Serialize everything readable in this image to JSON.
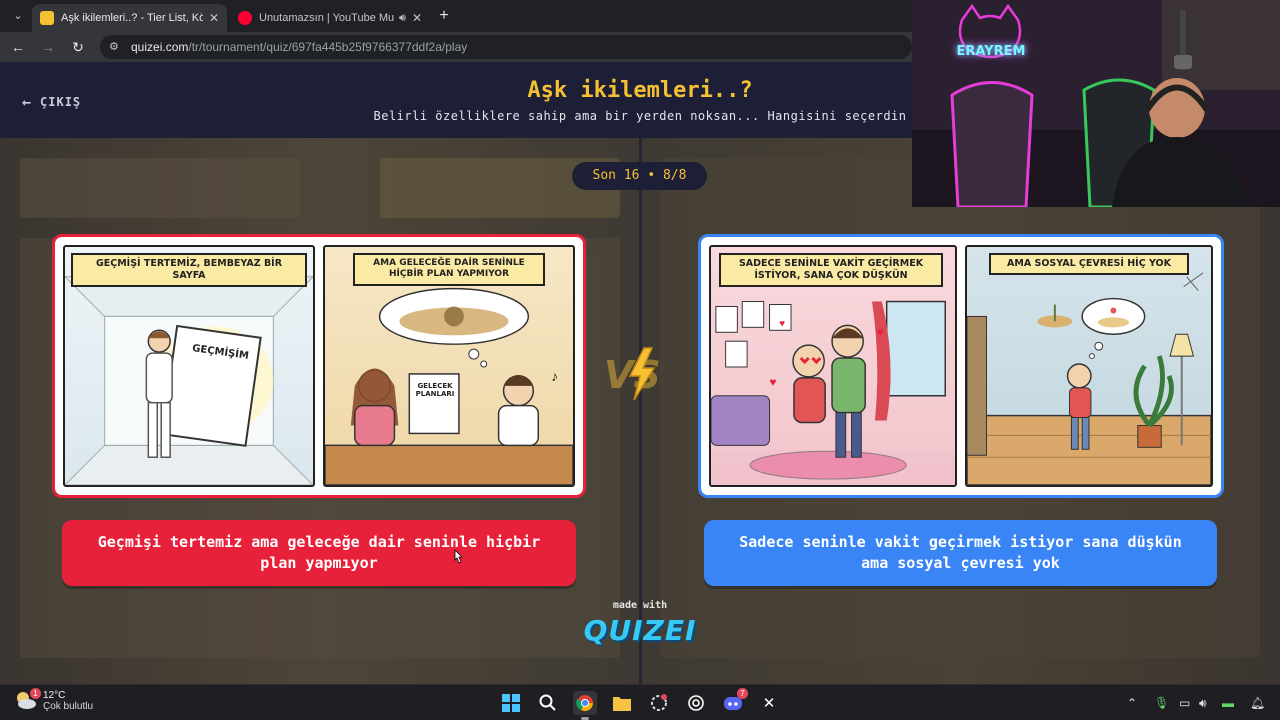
{
  "browser": {
    "tabs": [
      {
        "title": "Aşk ikilemleri..? - Tier List, Kör S",
        "favicon_color": "#f5c133",
        "active": true
      },
      {
        "title": "Unutamazsın | YouTube Mu",
        "favicon_color": "#ff0033",
        "active": false,
        "audio": true
      }
    ],
    "url_host": "quizei.com",
    "url_path": "/tr/tournament/quiz/697fa445b25f9766377ddf2a/play"
  },
  "page": {
    "exit_label": "ÇIKIŞ",
    "title": "Aşk ikilemleri..?",
    "subtitle": "Belirli özelliklere sahip ama bir yerden noksan... Hangisini seçerdin",
    "round_badge": "Son 16 • 8/8",
    "vs_label": "VS",
    "made_with": "made with",
    "brand": "QUIZEI"
  },
  "options": [
    {
      "panel1_caption": "GEÇMİŞİ TERTEMİZ, BEMBEYAZ BİR SAYFA",
      "panel1_prop": "GEÇMİŞİM",
      "panel2_caption": "AMA GELECEĞE DAİR SENİNLE HİÇBİR PLAN YAPMIYOR",
      "panel2_prop": "GELECEK PLANLARI",
      "button_label": "Geçmişi tertemiz ama geleceğe dair seninle hiçbir plan yapmıyor",
      "accent": "#e8213a"
    },
    {
      "panel1_caption": "SADECE SENİNLE VAKİT GEÇİRMEK İSTİYOR, SANA ÇOK DÜŞKÜN",
      "panel2_caption": "AMA SOSYAL ÇEVRESİ HİÇ YOK",
      "button_label": "Sadece seninle vakit geçirmek istiyor sana düşkün ama sosyal çevresi yok",
      "accent": "#3a85f5"
    }
  ],
  "webcam": {
    "neon_text": "ERAYREM"
  },
  "taskbar": {
    "weather_temp": "12°C",
    "weather_desc": "Çok bulutlu",
    "weather_badge": "1",
    "discord_badge": "7",
    "apps": [
      "windows-start-icon",
      "search-icon",
      "chrome-icon",
      "file-explorer-icon",
      "browser-icon",
      "chatgpt-icon",
      "discord-icon",
      "x-icon"
    ]
  }
}
